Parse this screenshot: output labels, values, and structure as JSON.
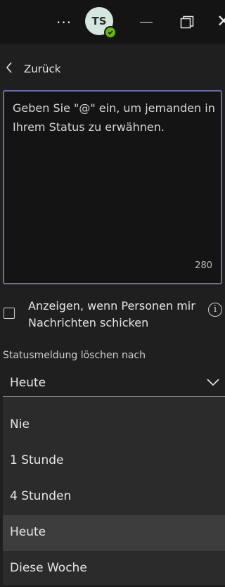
{
  "titlebar": {
    "more_label": "···",
    "avatar_initials": "TS",
    "presence_icon": "check-icon",
    "close_label": "✕"
  },
  "back": {
    "label": "Zurück",
    "icon": "chevron-left-icon"
  },
  "status": {
    "placeholder": "Geben Sie \"@\" ein, um jemanden in Ihrem Status zu erwähnen.",
    "char_count": "280"
  },
  "notify": {
    "label": "Anzeigen, wenn Personen mir Nachrichten schicken",
    "checked": false,
    "info_icon": "info-icon",
    "info_glyph": "i"
  },
  "clear_after": {
    "label": "Statusmeldung löschen nach",
    "selected": "Heute",
    "options": [
      "Nie",
      "1 Stunde",
      "4 Stunden",
      "Heute",
      "Diese Woche"
    ]
  },
  "colors": {
    "accent_border": "#6a6ea8",
    "presence_green": "#6bb700",
    "avatar_bg": "#d4e7de"
  }
}
